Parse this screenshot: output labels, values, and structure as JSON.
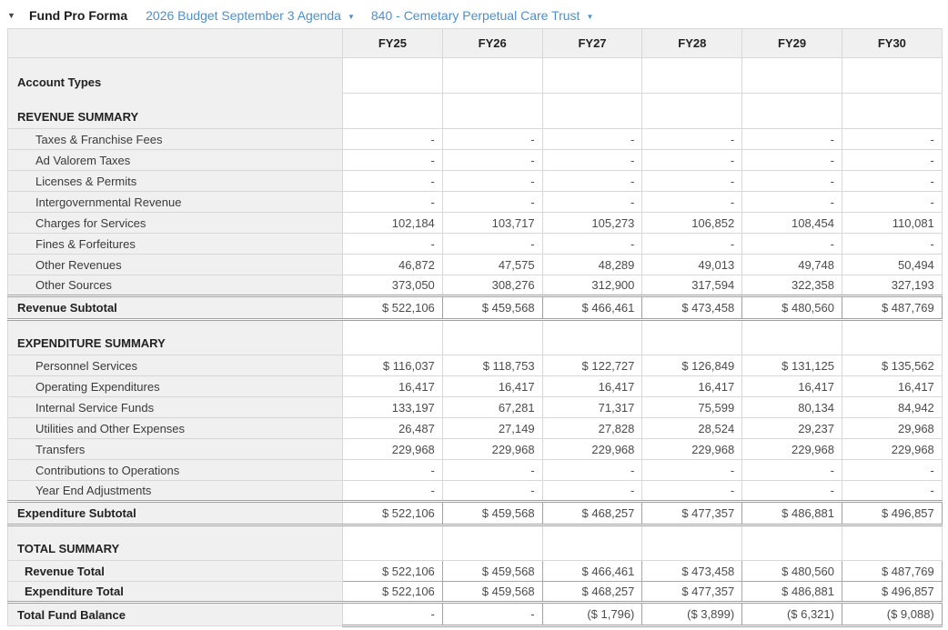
{
  "glyphs": {
    "triangle_down": "▼"
  },
  "colors": {
    "link_blue": "#4a90d2",
    "label_bg": "#f0f0f0",
    "grid_border": "#d8d8d8",
    "emphasis_border": "#a0a0a0"
  },
  "titlebar": {
    "collapse_icon": "triangle-down",
    "title": "Fund Pro Forma",
    "dropdowns": [
      {
        "label": "2026 Budget September 3 Agenda"
      },
      {
        "label": "840 - Cemetary Perpetual Care Trust"
      }
    ]
  },
  "table": {
    "columns": [
      "FY25",
      "FY26",
      "FY27",
      "FY28",
      "FY29",
      "FY30"
    ],
    "rows": [
      {
        "type": "section-first",
        "label": "Account Types",
        "values": [
          "",
          "",
          "",
          "",
          "",
          ""
        ]
      },
      {
        "type": "section",
        "label": "REVENUE SUMMARY",
        "values": [
          "",
          "",
          "",
          "",
          "",
          ""
        ]
      },
      {
        "type": "detail",
        "label": "Taxes & Franchise Fees",
        "values": [
          "-",
          "-",
          "-",
          "-",
          "-",
          "-"
        ]
      },
      {
        "type": "detail",
        "label": "Ad Valorem Taxes",
        "values": [
          "-",
          "-",
          "-",
          "-",
          "-",
          "-"
        ]
      },
      {
        "type": "detail",
        "label": "Licenses & Permits",
        "values": [
          "-",
          "-",
          "-",
          "-",
          "-",
          "-"
        ]
      },
      {
        "type": "detail",
        "label": "Intergovernmental Revenue",
        "values": [
          "-",
          "-",
          "-",
          "-",
          "-",
          "-"
        ]
      },
      {
        "type": "detail",
        "label": "Charges for Services",
        "values": [
          "102,184",
          "103,717",
          "105,273",
          "106,852",
          "108,454",
          "110,081"
        ]
      },
      {
        "type": "detail",
        "label": "Fines & Forfeitures",
        "values": [
          "-",
          "-",
          "-",
          "-",
          "-",
          "-"
        ]
      },
      {
        "type": "detail",
        "label": "Other Revenues",
        "values": [
          "46,872",
          "47,575",
          "48,289",
          "49,013",
          "49,748",
          "50,494"
        ]
      },
      {
        "type": "detail",
        "label": "Other Sources",
        "values": [
          "373,050",
          "308,276",
          "312,900",
          "317,594",
          "322,358",
          "327,193"
        ]
      },
      {
        "type": "subtotal",
        "label": "Revenue Subtotal",
        "values": [
          "$ 522,106",
          "$ 459,568",
          "$ 466,461",
          "$ 473,458",
          "$ 480,560",
          "$ 487,769"
        ]
      },
      {
        "type": "section",
        "label": "EXPENDITURE SUMMARY",
        "values": [
          "",
          "",
          "",
          "",
          "",
          ""
        ]
      },
      {
        "type": "detail",
        "label": "Personnel Services",
        "values": [
          "$ 116,037",
          "$ 118,753",
          "$ 122,727",
          "$ 126,849",
          "$ 131,125",
          "$ 135,562"
        ]
      },
      {
        "type": "detail",
        "label": "Operating Expenditures",
        "values": [
          "16,417",
          "16,417",
          "16,417",
          "16,417",
          "16,417",
          "16,417"
        ]
      },
      {
        "type": "detail",
        "label": "Internal Service Funds",
        "values": [
          "133,197",
          "67,281",
          "71,317",
          "75,599",
          "80,134",
          "84,942"
        ]
      },
      {
        "type": "detail",
        "label": "Utilities and Other Expenses",
        "values": [
          "26,487",
          "27,149",
          "27,828",
          "28,524",
          "29,237",
          "29,968"
        ]
      },
      {
        "type": "detail",
        "label": "Transfers",
        "values": [
          "229,968",
          "229,968",
          "229,968",
          "229,968",
          "229,968",
          "229,968"
        ]
      },
      {
        "type": "detail",
        "label": "Contributions to Operations",
        "values": [
          "-",
          "-",
          "-",
          "-",
          "-",
          "-"
        ]
      },
      {
        "type": "detail",
        "label": "Year End Adjustments",
        "values": [
          "-",
          "-",
          "-",
          "-",
          "-",
          "-"
        ]
      },
      {
        "type": "subtotal",
        "label": "Expenditure Subtotal",
        "values": [
          "$ 522,106",
          "$ 459,568",
          "$ 468,257",
          "$ 477,357",
          "$ 486,881",
          "$ 496,857"
        ]
      },
      {
        "type": "section",
        "label": "TOTAL SUMMARY",
        "values": [
          "",
          "",
          "",
          "",
          "",
          ""
        ]
      },
      {
        "type": "total",
        "label": "Revenue Total",
        "values": [
          "$ 522,106",
          "$ 459,568",
          "$ 466,461",
          "$ 473,458",
          "$ 480,560",
          "$ 487,769"
        ]
      },
      {
        "type": "total",
        "label": "Expenditure Total",
        "values": [
          "$ 522,106",
          "$ 459,568",
          "$ 468,257",
          "$ 477,357",
          "$ 486,881",
          "$ 496,857"
        ]
      },
      {
        "type": "fund-balance",
        "label": "Total Fund Balance",
        "values": [
          "-",
          "-",
          "($ 1,796)",
          "($ 3,899)",
          "($ 6,321)",
          "($ 9,088)"
        ]
      }
    ]
  }
}
